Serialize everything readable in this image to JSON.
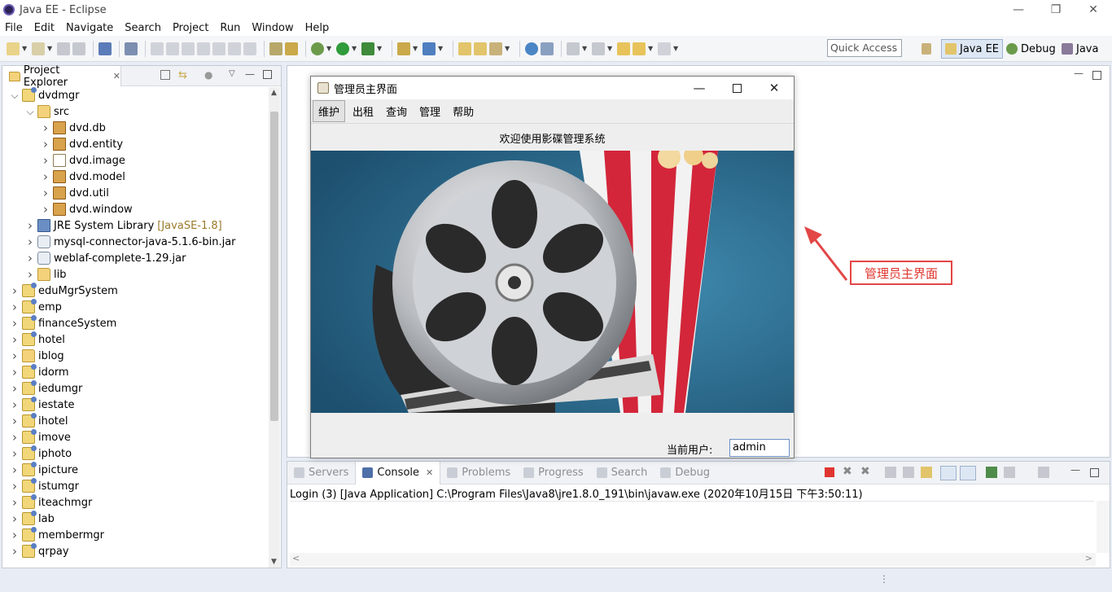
{
  "window": {
    "title": "Java EE - Eclipse"
  },
  "menu": [
    "File",
    "Edit",
    "Navigate",
    "Search",
    "Project",
    "Run",
    "Window",
    "Help"
  ],
  "toolbar": {
    "quick_access": "Quick Access"
  },
  "perspectives": [
    {
      "label": "Java EE",
      "icon": "javaee-perspective-icon"
    },
    {
      "label": "Debug",
      "icon": "debug-perspective-icon"
    },
    {
      "label": "Java",
      "icon": "java-perspective-icon"
    }
  ],
  "explorer": {
    "tab_label": "Project Explorer",
    "items": [
      {
        "label": "dvdmgr",
        "icon": "project-icon",
        "expanded": true,
        "level": 0
      },
      {
        "label": "src",
        "icon": "source-folder-icon",
        "expanded": true,
        "level": 1
      },
      {
        "label": "dvd.db",
        "icon": "package-icon",
        "expanded": false,
        "level": 2
      },
      {
        "label": "dvd.entity",
        "icon": "package-icon",
        "expanded": false,
        "level": 2
      },
      {
        "label": "dvd.image",
        "icon": "empty-package-icon",
        "expanded": false,
        "level": 2
      },
      {
        "label": "dvd.model",
        "icon": "package-icon",
        "expanded": false,
        "level": 2
      },
      {
        "label": "dvd.util",
        "icon": "package-icon",
        "expanded": false,
        "level": 2
      },
      {
        "label": "dvd.window",
        "icon": "package-icon",
        "expanded": false,
        "level": 2
      },
      {
        "label": "JRE System Library",
        "suffix": "[JavaSE-1.8]",
        "icon": "library-icon",
        "expanded": false,
        "level": 1
      },
      {
        "label": "mysql-connector-java-5.1.6-bin.jar",
        "icon": "jar-icon",
        "expanded": false,
        "level": 1
      },
      {
        "label": "weblaf-complete-1.29.jar",
        "icon": "jar-icon",
        "expanded": false,
        "level": 1
      },
      {
        "label": "lib",
        "icon": "folder-icon",
        "expanded": false,
        "level": 1
      },
      {
        "label": "eduMgrSystem",
        "icon": "project-icon",
        "expanded": false,
        "level": 0
      },
      {
        "label": "emp",
        "icon": "project-icon",
        "expanded": false,
        "level": 0
      },
      {
        "label": "financeSystem",
        "icon": "project-icon",
        "expanded": false,
        "level": 0
      },
      {
        "label": "hotel",
        "icon": "project-icon",
        "expanded": false,
        "level": 0
      },
      {
        "label": "iblog",
        "icon": "folder-icon",
        "expanded": false,
        "level": 0
      },
      {
        "label": "idorm",
        "icon": "project-icon",
        "expanded": false,
        "level": 0
      },
      {
        "label": "iedumgr",
        "icon": "project-icon",
        "expanded": false,
        "level": 0
      },
      {
        "label": "iestate",
        "icon": "project-icon",
        "expanded": false,
        "level": 0
      },
      {
        "label": "ihotel",
        "icon": "project-icon",
        "expanded": false,
        "level": 0
      },
      {
        "label": "imove",
        "icon": "project-icon",
        "expanded": false,
        "level": 0
      },
      {
        "label": "iphoto",
        "icon": "project-icon",
        "expanded": false,
        "level": 0
      },
      {
        "label": "ipicture",
        "icon": "project-icon",
        "expanded": false,
        "level": 0
      },
      {
        "label": "istumgr",
        "icon": "project-icon",
        "expanded": false,
        "level": 0
      },
      {
        "label": "iteachmgr",
        "icon": "project-icon",
        "expanded": false,
        "level": 0
      },
      {
        "label": "lab",
        "icon": "project-icon",
        "expanded": false,
        "level": 0
      },
      {
        "label": "membermgr",
        "icon": "project-icon",
        "expanded": false,
        "level": 0
      },
      {
        "label": "qrpay",
        "icon": "project-icon",
        "expanded": false,
        "level": 0
      }
    ]
  },
  "console": {
    "tabs": [
      {
        "label": "Servers",
        "active": false
      },
      {
        "label": "Console",
        "active": true
      },
      {
        "label": "Problems",
        "active": false
      },
      {
        "label": "Progress",
        "active": false
      },
      {
        "label": "Search",
        "active": false
      },
      {
        "label": "Debug",
        "active": false
      }
    ],
    "line": "Login (3) [Java Application] C:\\Program Files\\Java8\\jre1.8.0_191\\bin\\javaw.exe (2020年10月15日 下午3:50:11)"
  },
  "app_window": {
    "title": "管理员主界面",
    "menu": [
      "维护",
      "出租",
      "查询",
      "管理",
      "帮助"
    ],
    "welcome": "欢迎使用影碟管理系统",
    "user_label": "当前用户:",
    "user_value": "admin"
  },
  "annotation": {
    "label": "管理员主界面",
    "color": "#e34646"
  },
  "colors": {
    "accent_red": "#e34646",
    "image_bg": "#2d6f93"
  }
}
